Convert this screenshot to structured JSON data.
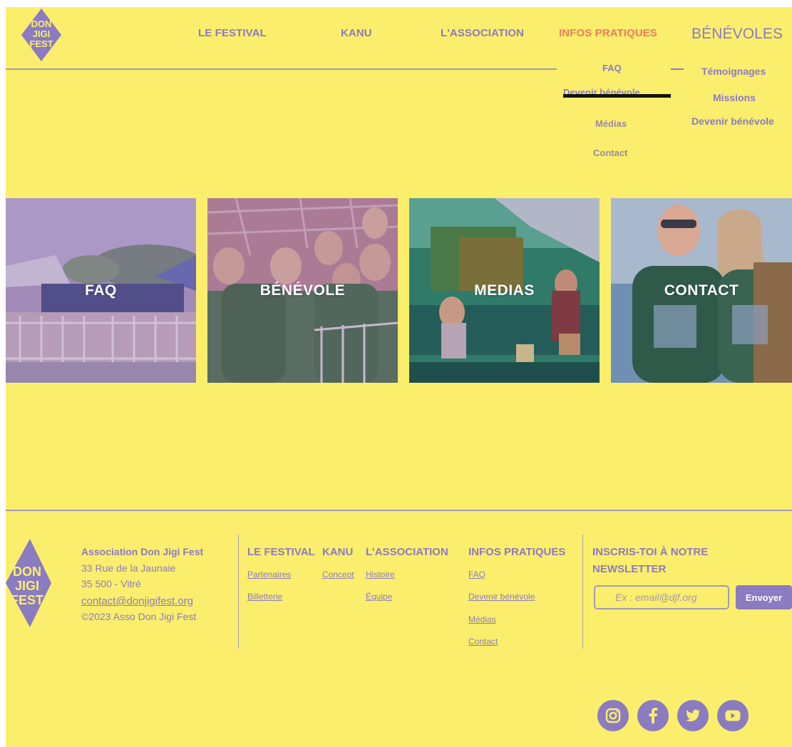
{
  "header": {
    "logo_text": [
      "DON",
      "JIGI",
      "FEST"
    ],
    "nav": [
      "LE FESTIVAL",
      "KANU",
      "L'ASSOCIATION",
      "INFOS PRATIQUES"
    ],
    "benevoles": "BÉNÉVOLES",
    "infos_submenu": [
      "FAQ",
      "Devenir bénévole",
      "Médias",
      "Contact"
    ],
    "benevoles_submenu": [
      "Témoignages",
      "Missions",
      "Devenir bénévole"
    ]
  },
  "tiles": [
    "FAQ",
    "BÉNÉVOLE",
    "MEDIAS",
    "CONTACT"
  ],
  "footer": {
    "org_name": "Association Don Jigi Fest",
    "address1": "33 Rue de la Jaunaie",
    "address2": "35 500 - Vitré",
    "email": "contact@donjigifest.org",
    "copyright": "©2023 Asso Don Jigi Fest",
    "col_festival": {
      "title": "LE FESTIVAL",
      "links": [
        "Partenaires",
        "Billetterie"
      ]
    },
    "col_kanu": {
      "title": "KANU",
      "links": [
        "Concept"
      ]
    },
    "col_association": {
      "title": "L'ASSOCIATION",
      "links": [
        "Histoire",
        "Équipe"
      ]
    },
    "col_infos": {
      "title": "INFOS PRATIQUES",
      "links": [
        "FAQ",
        "Devenir bénévole",
        "Médias",
        "Contact"
      ]
    },
    "newsletter": {
      "title1": "INSCRIS-TOI À NOTRE",
      "title2": "NEWSLETTER",
      "placeholder": "Ex : email@djf.org",
      "button": "Envoyer"
    }
  },
  "colors": {
    "background": "#fbee6d",
    "accent": "#8b7bc1",
    "active": "#f07a5d"
  },
  "social_icons": [
    "instagram-icon",
    "facebook-icon",
    "twitter-icon",
    "youtube-icon"
  ]
}
